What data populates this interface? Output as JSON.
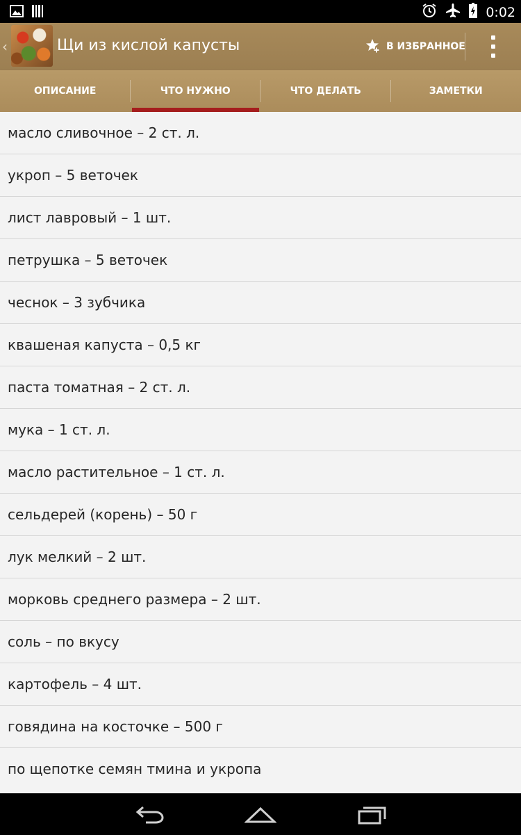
{
  "status_bar": {
    "time": "0:02",
    "icons": [
      "image-notification-icon",
      "barcode-notification-icon",
      "alarm-icon",
      "airplane-mode-icon",
      "battery-charging-icon"
    ]
  },
  "app_bar": {
    "back_glyph": "‹",
    "title": "Щи из кислой капусты",
    "favorite_label": "В ИЗБРАННОЕ",
    "bg_color": "#9c7f52"
  },
  "tabs": [
    {
      "label": "ОПИСАНИЕ",
      "active": false
    },
    {
      "label": "ЧТО НУЖНО",
      "active": true
    },
    {
      "label": "ЧТО ДЕЛАТЬ",
      "active": false
    },
    {
      "label": "ЗАМЕТКИ",
      "active": false
    }
  ],
  "active_tab_indicator_color": "#a51d1d",
  "ingredients": [
    "масло сливочное – 2 ст. л.",
    "укроп – 5 веточек",
    "лист лавровый – 1 шт.",
    "петрушка – 5 веточек",
    "чеснок – 3 зубчика",
    "квашеная капуста – 0,5 кг",
    "паста томатная – 2 ст. л.",
    "мука – 1 ст. л.",
    "масло растительное – 1 ст. л.",
    "сельдерей (корень) – 50 г",
    "лук мелкий – 2 шт.",
    "морковь среднего размера – 2 шт.",
    "соль – по вкусу",
    "картофель – 4 шт.",
    "говядина на косточке – 500 г",
    "по щепотке семян тмина и укропа"
  ],
  "nav_bar": {
    "icons": [
      "back-icon",
      "home-icon",
      "recent-apps-icon"
    ]
  }
}
